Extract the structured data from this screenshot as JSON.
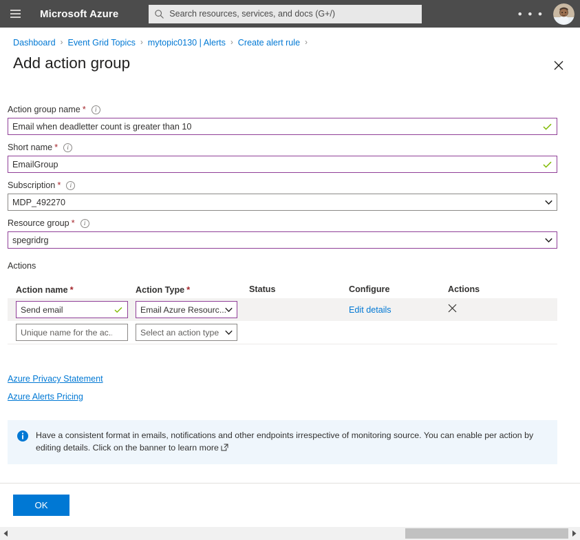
{
  "topbar": {
    "menu_icon": "hamburger-icon",
    "brand": "Microsoft Azure",
    "search_placeholder": "Search resources, services, and docs (G+/)",
    "search_icon": "search-icon",
    "more_label": "• • •",
    "avatar_label": "user-avatar"
  },
  "breadcrumb": {
    "items": [
      {
        "label": "Dashboard"
      },
      {
        "label": "Event Grid Topics"
      },
      {
        "label": "mytopic0130 | Alerts"
      },
      {
        "label": "Create alert rule"
      }
    ],
    "separator": "›"
  },
  "page": {
    "title": "Add action group",
    "close_icon": "close-icon"
  },
  "form": {
    "action_group_name": {
      "label": "Action group name",
      "required": "*",
      "info_icon": "info-icon",
      "value": "Email when deadletter count is greater than 10",
      "validation_icon": "checkmark-icon"
    },
    "short_name": {
      "label": "Short name",
      "required": "*",
      "info_icon": "info-icon",
      "value": "EmailGroup",
      "validation_icon": "checkmark-icon"
    },
    "subscription": {
      "label": "Subscription",
      "required": "*",
      "info_icon": "info-icon",
      "value": "MDP_492270",
      "chevron_icon": "chevron-down-icon"
    },
    "resource_group": {
      "label": "Resource group",
      "required": "*",
      "info_icon": "info-icon",
      "value": "spegridrg",
      "chevron_icon": "chevron-down-icon"
    }
  },
  "actions_section": {
    "heading": "Actions",
    "columns": {
      "name": "Action name",
      "name_required": "*",
      "type": "Action Type",
      "type_required": "*",
      "status": "Status",
      "configure": "Configure",
      "actions": "Actions"
    },
    "rows": [
      {
        "name_value": "Send email",
        "name_valid_icon": "checkmark-icon",
        "type_value": "Email Azure Resourc...",
        "type_chevron": "chevron-down-icon",
        "status": "",
        "configure_link": "Edit details",
        "delete_icon": "close-icon"
      },
      {
        "name_placeholder": "Unique name for the ac...",
        "name_value": "",
        "type_value": "Select an action type",
        "type_chevron": "chevron-down-icon",
        "status": "",
        "configure_link": "",
        "delete_icon": ""
      }
    ]
  },
  "doc_links": [
    {
      "label": "Azure Privacy Statement"
    },
    {
      "label": "Azure Alerts Pricing"
    }
  ],
  "banner": {
    "icon": "info-filled-icon",
    "text": "Have a consistent format in emails, notifications and other endpoints irrespective of monitoring source. You can enable per action by editing details. Click on the banner to learn more",
    "external_icon": "external-link-icon"
  },
  "footer": {
    "ok_label": "OK"
  },
  "scrollbar": {
    "left_arrow": "triangle-left-icon",
    "right_arrow": "triangle-right-icon",
    "thumb": "scroll-thumb"
  },
  "colors": {
    "accent_blue": "#0078d4",
    "topbar_bg": "#4c4c4c",
    "validation_purple": "#8f3e97",
    "check_green": "#7fba00",
    "required_red": "#a4262c",
    "banner_bg": "#eff6fc",
    "row_highlight": "#f3f2f1"
  }
}
